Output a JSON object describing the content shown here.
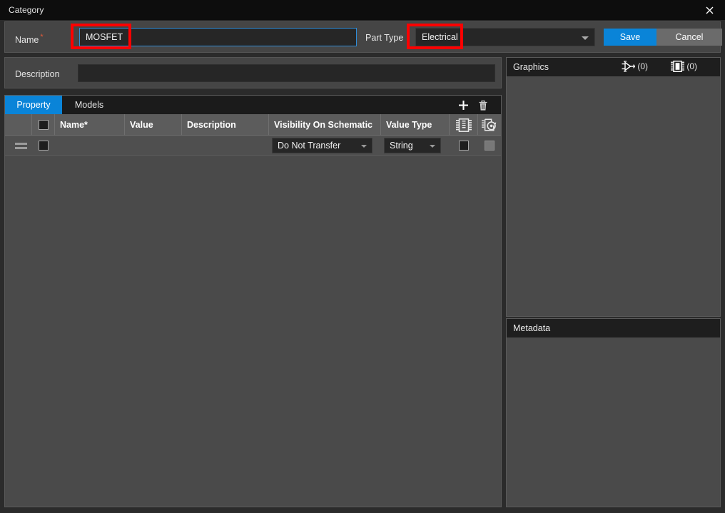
{
  "window": {
    "title": "Category",
    "close_icon": "close-icon"
  },
  "form": {
    "name_label": "Name",
    "name_required_marker": "*",
    "name_value": "MOSFET",
    "part_type_label": "Part Type",
    "part_type_value": "Electrical",
    "save_label": "Save",
    "cancel_label": "Cancel",
    "description_label": "Description",
    "description_value": "",
    "description_placeholder": ""
  },
  "tabs": [
    {
      "label": "Property",
      "active": true
    },
    {
      "label": "Models",
      "active": false
    }
  ],
  "toolbar": {
    "add_icon": "plus-icon",
    "delete_icon": "trash-icon"
  },
  "table": {
    "columns": [
      {
        "label": "",
        "kind": "drag"
      },
      {
        "label": "",
        "kind": "checkbox"
      },
      {
        "label": "Name*",
        "kind": "text"
      },
      {
        "label": "Value",
        "kind": "text"
      },
      {
        "label": "Description",
        "kind": "text"
      },
      {
        "label": "Visibility On Schematic",
        "kind": "text"
      },
      {
        "label": "Value Type",
        "kind": "text"
      },
      {
        "label": "",
        "kind": "icon",
        "icon": "ic-package-icon"
      },
      {
        "label": "",
        "kind": "icon",
        "icon": "ic-simulation-icon"
      }
    ],
    "rows": [
      {
        "drag_handle": "drag-handle-icon",
        "selected": false,
        "name": "",
        "value": "",
        "description": "",
        "visibility_on_schematic": "Do Not Transfer",
        "value_type": "String",
        "col_package_checked": false,
        "col_simulation_checked": false,
        "col_simulation_disabled": true
      }
    ]
  },
  "graphics": {
    "title": "Graphics",
    "gate_icon": "logic-gate-icon",
    "gate_count": "(0)",
    "chip_icon": "ic-chip-icon",
    "chip_count": "(0)"
  },
  "metadata": {
    "title": "Metadata"
  },
  "annotations": {
    "name_highlight_color": "#ff0000",
    "part_type_highlight_color": "#ff0000"
  },
  "colors": {
    "accent": "#0a84d8",
    "window_bg": "#2b2b2b",
    "panel_bg": "#4a4a4a",
    "header_bg": "#5c5c5c",
    "field_bg": "#262626",
    "titlebar_bg": "#0d0d0d",
    "required_marker": "#e05a3a"
  }
}
